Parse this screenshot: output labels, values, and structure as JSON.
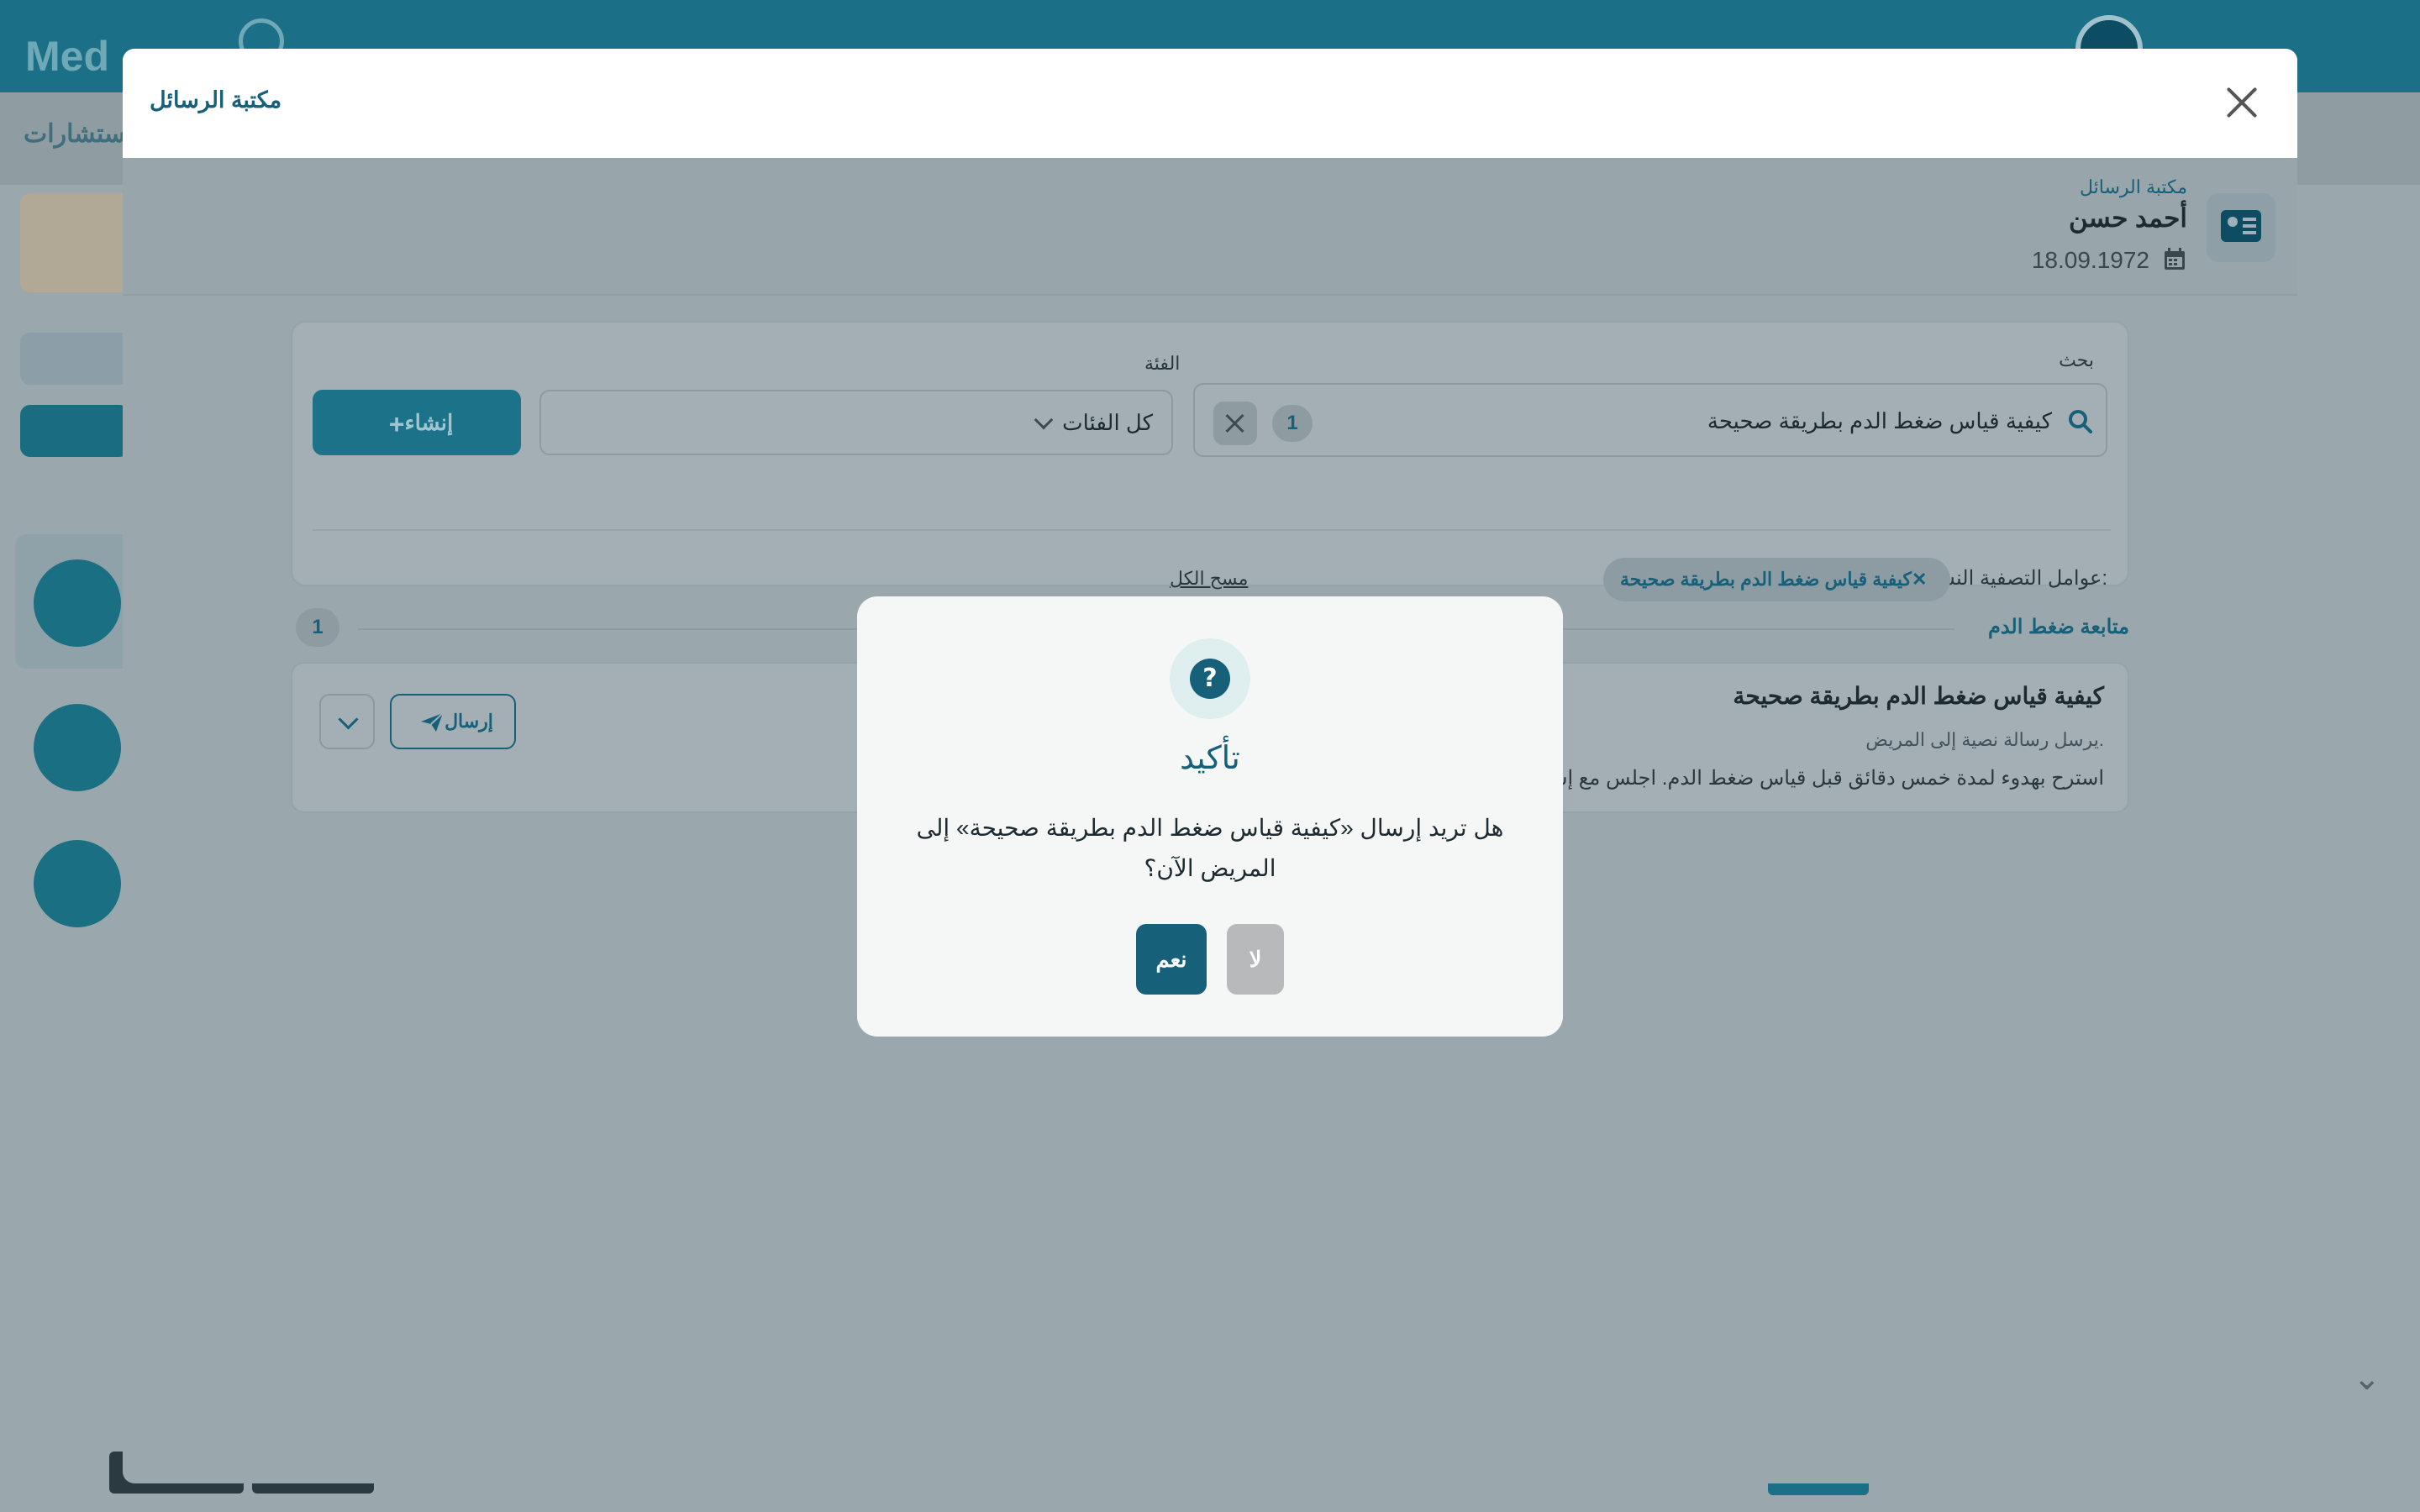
{
  "background": {
    "logo_text": "Med",
    "subheader_text": "الاستشارات"
  },
  "modal": {
    "title": "مكتبة الرسائل",
    "patient": {
      "label": "مكتبة الرسائل",
      "name": "أحمد حسن",
      "dob": "18.09.1972"
    },
    "filters": {
      "search_label": "بحث",
      "search_value": "كيفية قياس ضغط الدم بطريقة صحيحة",
      "search_count": "1",
      "category_label": "الفئة",
      "category_value": "كل الفئات",
      "create_label": "إنشاء",
      "active_label": "عوامل التصفية النشطة:",
      "active_chip": "كيفية قياس ضغط الدم بطريقة صحيحة",
      "clear_all": "مسح الكل"
    },
    "group": {
      "title": "متابعة ضغط الدم",
      "count": "1",
      "message": {
        "title": "كيفية قياس ضغط الدم بطريقة صحيحة",
        "subtitle": "يرسل رسالة نصية إلى المريض.",
        "body": "استرح بهدوء لمدة خمس دقائق قبل قياس ضغط الدم. اجلس مع إسناد",
        "send_label": "إرسال"
      }
    }
  },
  "confirm": {
    "icon": "?",
    "title": "تأكيد",
    "text": "هل تريد إرسال «كيفية قياس ضغط الدم بطريقة صحيحة» إلى المريض الآن؟",
    "yes_label": "نعم",
    "no_label": "لا"
  }
}
